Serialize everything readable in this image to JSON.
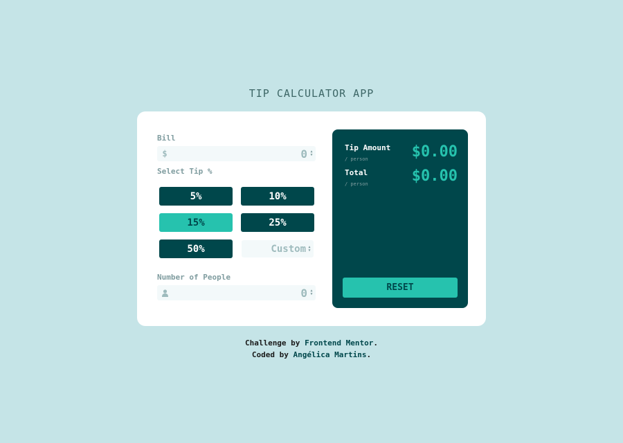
{
  "app": {
    "title": "TIP CALCULATOR APP"
  },
  "bill": {
    "label": "Bill",
    "prefix": "$",
    "value": "0"
  },
  "tip": {
    "label": "Select Tip %",
    "options": [
      "5%",
      "10%",
      "15%",
      "25%",
      "50%"
    ],
    "selected": "15%",
    "custom_placeholder": "Custom"
  },
  "people": {
    "label": "Number of People",
    "value": "0",
    "icon": "person-icon"
  },
  "results": {
    "tip_amount_label": "Tip Amount",
    "tip_amount_sub": "/ person",
    "tip_amount_value": "$0.00",
    "total_label": "Total",
    "total_sub": "/ person",
    "total_value": "$0.00",
    "reset_label": "RESET"
  },
  "attribution": {
    "line1_prefix": "Challenge by",
    "line1_link": "Frontend Mentor",
    "line1_suffix": ".",
    "line2_prefix": "Coded by",
    "line2_link": "Angélica Martins",
    "line2_suffix": "."
  },
  "colors": {
    "background": "#c5e4e7",
    "primary_dark": "#00474b",
    "accent": "#26c2ae",
    "muted": "#7f9c9f",
    "input_bg": "#f3f9fa"
  }
}
